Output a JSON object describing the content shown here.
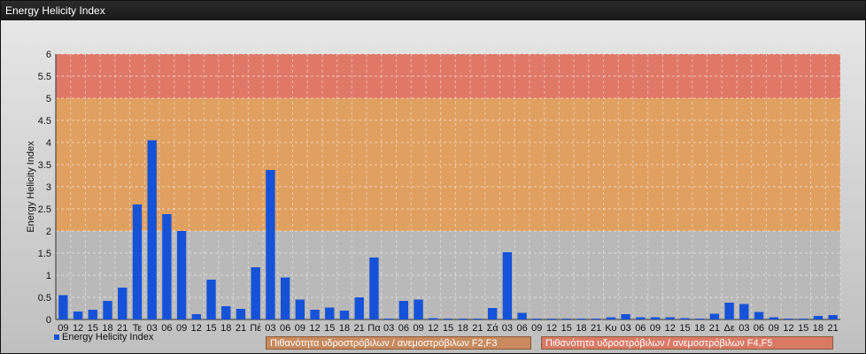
{
  "window": {
    "title": "Energy Helicity Index"
  },
  "legend": {
    "series_label": "Energy Helicity Index",
    "band1_label": "Πιθανότητα υδροστρόβιλων / ανεμοστρόβιλων F2,F3",
    "band2_label": "Πιθανότητα υδροστρόβιλων / ανεμοστρόβιλων F4,F5"
  },
  "colors": {
    "bar": "#1552d8",
    "band_low": "#b9b9b9",
    "band_mid": "#e0a060",
    "band_high": "#e07868",
    "band1_legend": "#c88a5e",
    "band2_legend": "#d97a66"
  },
  "chart_data": {
    "type": "bar",
    "title": "",
    "ylabel": "Energy Helicity Index",
    "xlabel": "",
    "ylim": [
      0,
      6
    ],
    "yticks": [
      "0",
      "0.5",
      "1",
      "1.5",
      "2",
      "2.5",
      "3",
      "3.5",
      "4",
      "4.5",
      "5",
      "5.5",
      "6"
    ],
    "grid": true,
    "legend_position": "bottom-left",
    "bands": [
      {
        "from": 0,
        "to": 2,
        "color": "band_low"
      },
      {
        "from": 2,
        "to": 5,
        "color": "band_mid"
      },
      {
        "from": 5,
        "to": 6,
        "color": "band_high"
      }
    ],
    "categories": [
      "09",
      "12",
      "15",
      "18",
      "21",
      "Τε",
      "03",
      "06",
      "09",
      "12",
      "15",
      "18",
      "21",
      "Πέ",
      "03",
      "06",
      "09",
      "12",
      "15",
      "18",
      "21",
      "Πα",
      "03",
      "06",
      "09",
      "12",
      "15",
      "18",
      "21",
      "Σά",
      "03",
      "06",
      "09",
      "12",
      "15",
      "18",
      "21",
      "Κυ",
      "03",
      "06",
      "09",
      "12",
      "15",
      "18",
      "21",
      "Δε",
      "03",
      "06",
      "09",
      "12",
      "15",
      "18",
      "21"
    ],
    "series": [
      {
        "name": "Energy Helicity Index",
        "values": [
          0.55,
          0.18,
          0.22,
          0.42,
          0.72,
          2.6,
          4.05,
          2.38,
          2.0,
          0.12,
          0.9,
          0.3,
          0.24,
          1.18,
          3.38,
          0.95,
          0.45,
          0.22,
          0.27,
          0.2,
          0.5,
          1.4,
          0.02,
          0.42,
          0.45,
          0.03,
          0.02,
          0.02,
          0.02,
          0.26,
          1.52,
          0.15,
          0.02,
          0.02,
          0.02,
          0.02,
          0.02,
          0.05,
          0.12,
          0.05,
          0.05,
          0.05,
          0.03,
          0.02,
          0.13,
          0.38,
          0.35,
          0.17,
          0.05,
          0.02,
          0.02,
          0.08,
          0.1
        ]
      }
    ]
  }
}
